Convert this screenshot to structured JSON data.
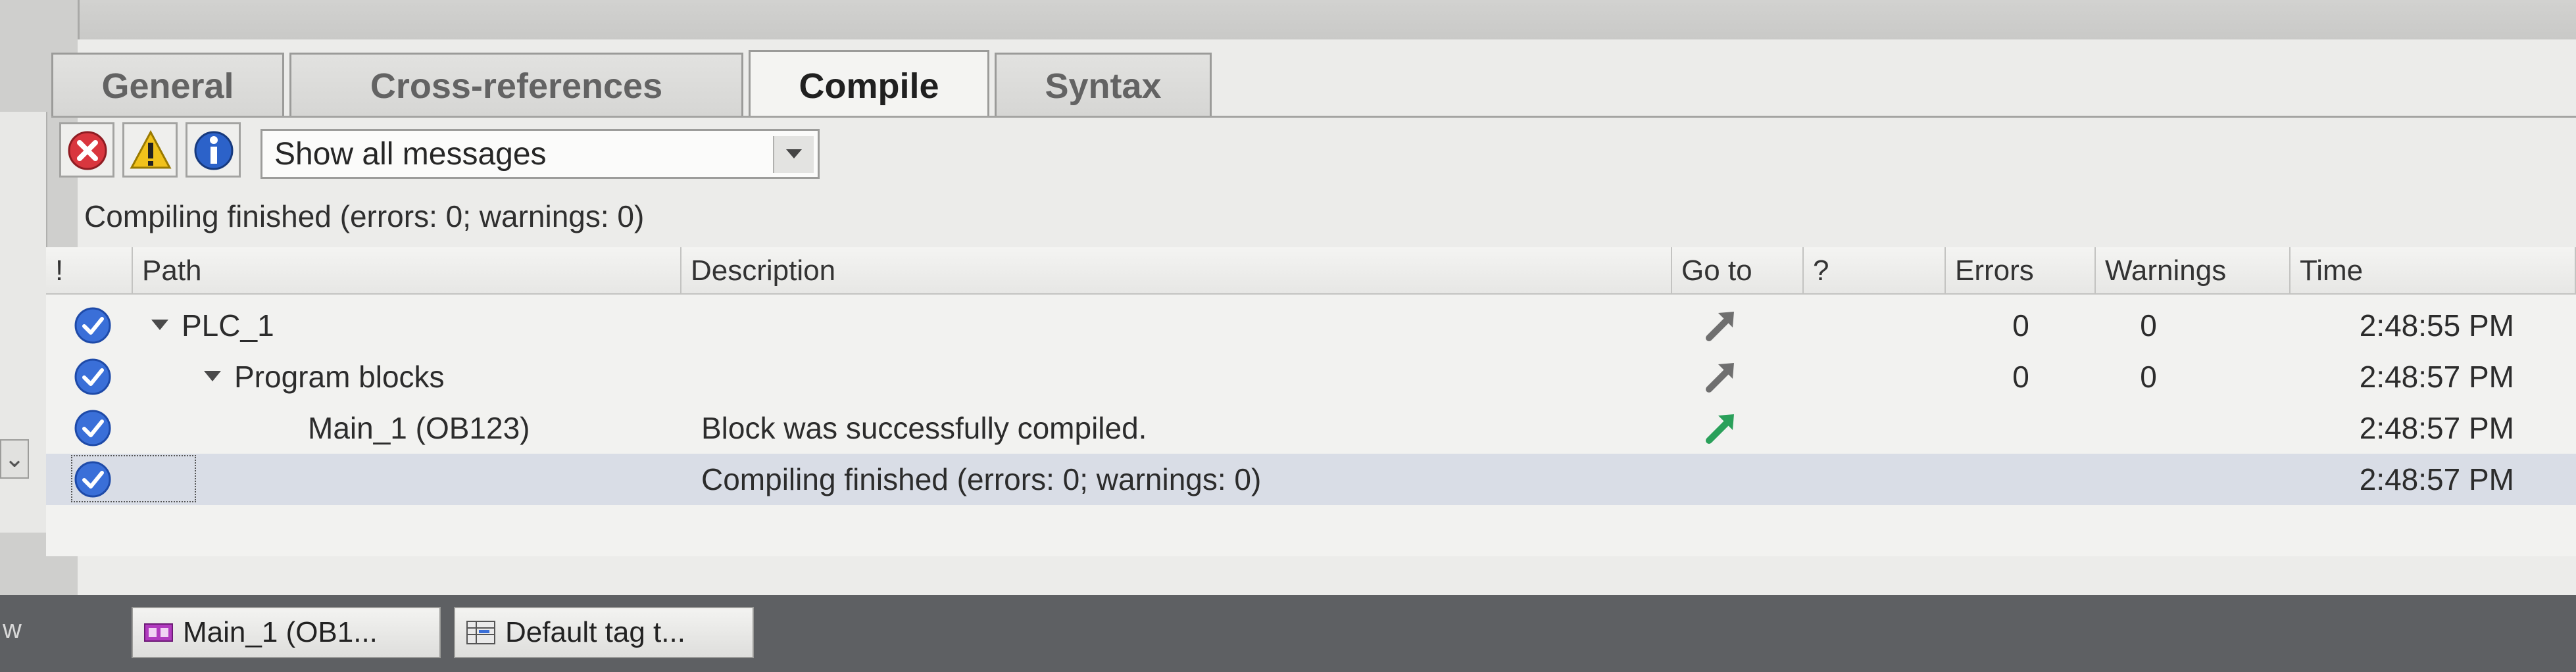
{
  "tabs": [
    {
      "label": "General",
      "active": false
    },
    {
      "label": "Cross-references",
      "active": false
    },
    {
      "label": "Compile",
      "active": true
    },
    {
      "label": "Syntax",
      "active": false
    }
  ],
  "toolbar": {
    "filter_select_value": "Show all messages"
  },
  "summary_text": "Compiling finished (errors: 0; warnings: 0)",
  "grid": {
    "columns": [
      "!",
      "Path",
      "Description",
      "Go to",
      "?",
      "Errors",
      "Warnings",
      "Time"
    ],
    "rows": [
      {
        "path": "PLC_1",
        "description": "",
        "goto": "grey",
        "errors": "0",
        "warnings": "0",
        "time": "2:48:55 PM"
      },
      {
        "path": "Program blocks",
        "description": "",
        "goto": "grey",
        "errors": "0",
        "warnings": "0",
        "time": "2:48:57 PM"
      },
      {
        "path": "Main_1 (OB123)",
        "description": "Block was successfully compiled.",
        "goto": "green",
        "errors": "",
        "warnings": "",
        "time": "2:48:57 PM"
      },
      {
        "path": "",
        "description": "Compiling finished (errors: 0; warnings: 0)",
        "goto": "",
        "errors": "",
        "warnings": "",
        "time": "2:48:57 PM"
      }
    ]
  },
  "taskbar": {
    "left_label": "w",
    "items": [
      {
        "label": "Main_1 (OB1...",
        "icon": "block-icon"
      },
      {
        "label": "Default tag t...",
        "icon": "tag-table-icon"
      }
    ]
  },
  "colors": {
    "success_blue": "#3a6fd8",
    "goto_grey": "#6f6f6f",
    "goto_green": "#2aa05a",
    "error_red": "#d9363e",
    "warning_yellow": "#f1c21b",
    "info_blue": "#2c62c9"
  }
}
